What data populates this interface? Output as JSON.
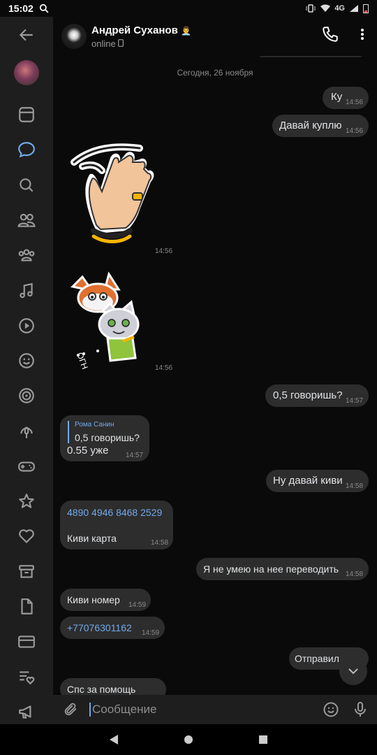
{
  "status": {
    "time": "15:02",
    "signal": "4G"
  },
  "header": {
    "name": "Андрей Суханов",
    "status": "online"
  },
  "date_separator": "Сегодня, 26 ноября",
  "messages": [
    {
      "text": "Ку",
      "time": "14:56"
    },
    {
      "text": "Давай куплю",
      "time": "14:56"
    },
    {
      "time": "14:56"
    },
    {
      "time": "14:56"
    },
    {
      "text": "0,5 говоришь?",
      "time": "14:57"
    },
    {
      "reply_author": "Рома Санин",
      "reply_text": "0,5 говоришь?",
      "text": "0.55 уже",
      "time": "14:57"
    },
    {
      "text": "Ну давай киви",
      "time": "14:58"
    },
    {
      "link": "4890 4946 8468 2529",
      "text": "Киви карта",
      "time": "14:58"
    },
    {
      "text": "Я не умею на нее переводить",
      "time": "14:58"
    },
    {
      "text": "Киви номер",
      "time": "14:59"
    },
    {
      "link": "+77076301162",
      "time": "14:59"
    },
    {
      "text": "Отправил"
    },
    {
      "text": "Спс за помощь"
    }
  ],
  "input": {
    "placeholder": "Сообщение"
  },
  "colors": {
    "accent": "#71aaeb",
    "bubble": "#2d2d2d",
    "sidebar": "#1e1e1e"
  }
}
